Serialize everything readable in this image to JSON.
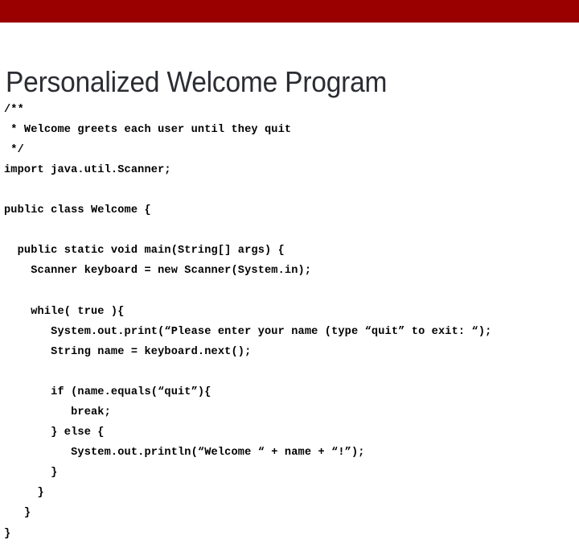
{
  "slide": {
    "title": "Personalized Welcome Program",
    "accent_color": "#9b0000",
    "title_color": "#2b2d33",
    "background_color": "#ffffff",
    "code_color": "#000000"
  },
  "header": {
    "bar_label": "decorative-red-banner"
  },
  "code": {
    "language": "java",
    "lines": [
      "/**",
      " * Welcome greets each user until they quit",
      " */",
      "import java.util.Scanner;",
      "",
      "public class Welcome {",
      "",
      "  public static void main(String[] args) {",
      "    Scanner keyboard = new Scanner(System.in);",
      "",
      "    while( true ){",
      "       System.out.print(“Please enter your name (type “quit” to exit: “);",
      "       String name = keyboard.next();",
      "",
      "       if (name.equals(“quit”){",
      "          break;",
      "       } else {",
      "          System.out.println(“Welcome “ + name + “!”);",
      "       }",
      "     }",
      "   }",
      "}"
    ]
  }
}
